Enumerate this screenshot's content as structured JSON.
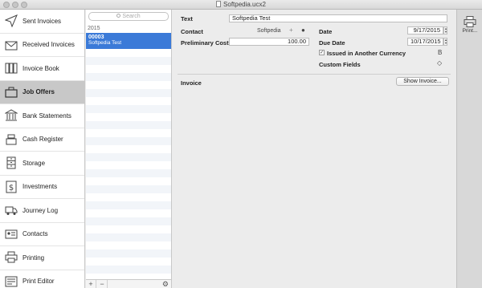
{
  "window": {
    "title": "Softpedia.ucx2"
  },
  "sidebar": {
    "items": [
      {
        "label": "Sent Invoices",
        "icon": "send-icon"
      },
      {
        "label": "Received Invoices",
        "icon": "envelope-icon"
      },
      {
        "label": "Invoice Book",
        "icon": "book-icon"
      },
      {
        "label": "Job Offers",
        "icon": "briefcase-icon"
      },
      {
        "label": "Bank Statements",
        "icon": "bank-icon"
      },
      {
        "label": "Cash Register",
        "icon": "cash-register-icon"
      },
      {
        "label": "Storage",
        "icon": "cabinet-icon"
      },
      {
        "label": "Investments",
        "icon": "dollar-icon"
      },
      {
        "label": "Journey Log",
        "icon": "truck-icon"
      },
      {
        "label": "Contacts",
        "icon": "contact-card-icon"
      },
      {
        "label": "Printing",
        "icon": "printer-icon"
      },
      {
        "label": "Print Editor",
        "icon": "print-editor-icon"
      }
    ],
    "active_index": 3
  },
  "list": {
    "search_placeholder": "Search",
    "year": "2015",
    "selected": {
      "number": "00003",
      "customer": "Softpedia Test"
    },
    "footer": {
      "add": "+",
      "remove": "−",
      "gear": "⚙"
    }
  },
  "detail": {
    "text_label": "Text",
    "text_value": "Softpedia Test",
    "contact_label": "Contact",
    "contact_value": "Softpedia",
    "prelim_label": "Preliminary Cost",
    "prelim_value": "100.00",
    "date_label": "Date",
    "date_value": "9/17/2015",
    "due_label": "Due Date",
    "due_value": "10/17/2015",
    "issued_label": "Issued in Another Currency",
    "issued_checked": true,
    "custom_fields_label": "Custom Fields",
    "invoice_label": "Invoice",
    "show_invoice_button": "Show Invoice..."
  },
  "toolbar": {
    "print_label": "Print..."
  }
}
